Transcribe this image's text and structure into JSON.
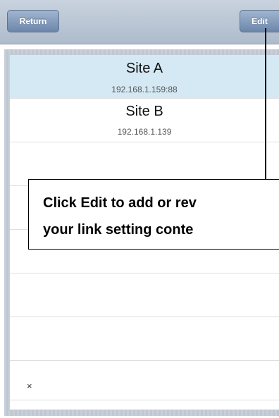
{
  "toolbar": {
    "return_label": "Return",
    "edit_label": "Edit"
  },
  "sites": [
    {
      "name": "Site A",
      "address": "192.168.1.159:88",
      "selected": true
    },
    {
      "name": "Site B",
      "address": "192.168.1.139",
      "selected": false
    }
  ],
  "list": {
    "last_row_mark": "×"
  },
  "callout": {
    "line1": "Click Edit to add or rev",
    "line2": "your link setting conte"
  },
  "colors": {
    "toolbar": "#b8c4d3",
    "button": "#6c86aa",
    "selected_row": "#d4e9f4",
    "panel": "#c3cbd6"
  }
}
